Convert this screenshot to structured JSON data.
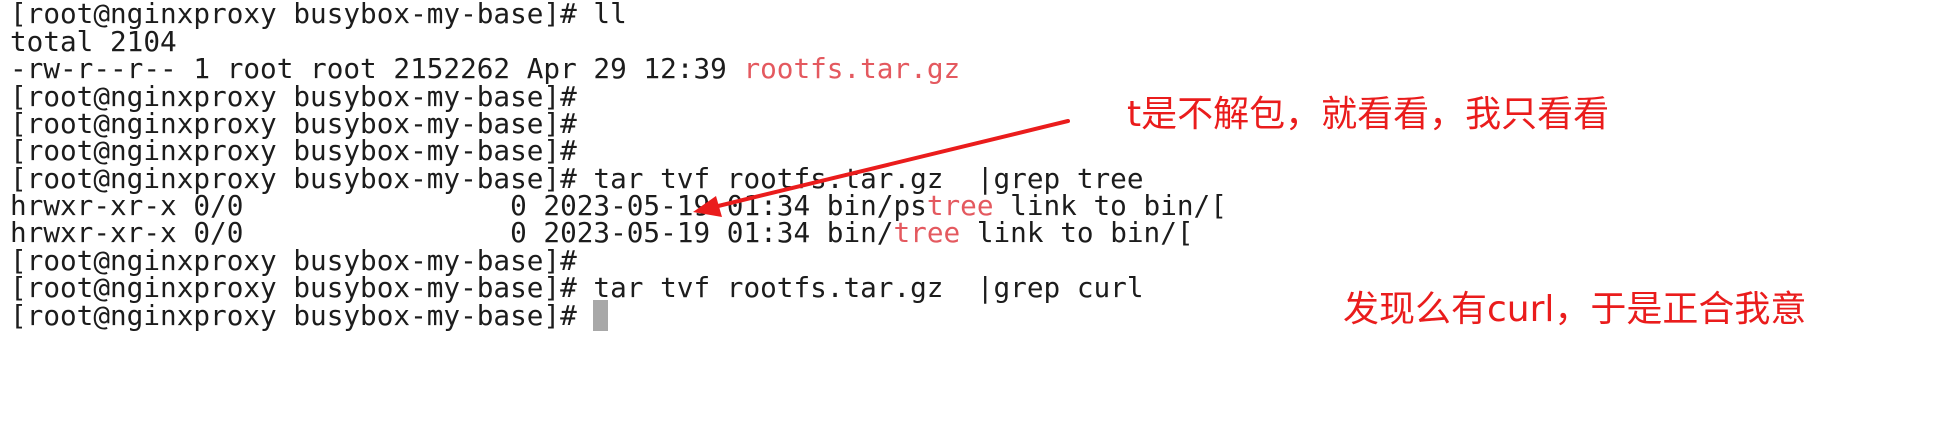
{
  "terminal": {
    "lines": [
      {
        "pre": "[root@nginxproxy busybox-my-base]# ll",
        "hl": "",
        "post": ""
      },
      {
        "pre": "total 2104",
        "hl": "",
        "post": ""
      },
      {
        "pre": "-rw-r--r-- 1 root root 2152262 Apr 29 12:39 ",
        "hl": "rootfs.tar.gz",
        "post": ""
      },
      {
        "pre": "[root@nginxproxy busybox-my-base]#",
        "hl": "",
        "post": ""
      },
      {
        "pre": "[root@nginxproxy busybox-my-base]#",
        "hl": "",
        "post": ""
      },
      {
        "pre": "[root@nginxproxy busybox-my-base]#",
        "hl": "",
        "post": ""
      },
      {
        "pre": "[root@nginxproxy busybox-my-base]# tar tvf rootfs.tar.gz  |grep tree",
        "hl": "",
        "post": ""
      },
      {
        "pre": "hrwxr-xr-x 0/0                0 2023-05-19 01:34 bin/ps",
        "hl": "tree",
        "post": " link to bin/["
      },
      {
        "pre": "hrwxr-xr-x 0/0                0 2023-05-19 01:34 bin/",
        "hl": "tree",
        "post": " link to bin/["
      },
      {
        "pre": "[root@nginxproxy busybox-my-base]#",
        "hl": "",
        "post": ""
      },
      {
        "pre": "[root@nginxproxy busybox-my-base]# tar tvf rootfs.tar.gz  |grep curl",
        "hl": "",
        "post": ""
      },
      {
        "pre": "[root@nginxproxy busybox-my-base]#",
        "hl": "",
        "post": ""
      }
    ]
  },
  "annotations": {
    "note_1": "t是不解包，就看看，我只看看",
    "note_2": "发现么有curl，于是正合我意"
  },
  "colors": {
    "background": "#ffffff",
    "text": "#1c1c1c",
    "highlight": "#e4595f",
    "annotation": "#ea1c1c",
    "cursor": "#a8a8a8"
  }
}
